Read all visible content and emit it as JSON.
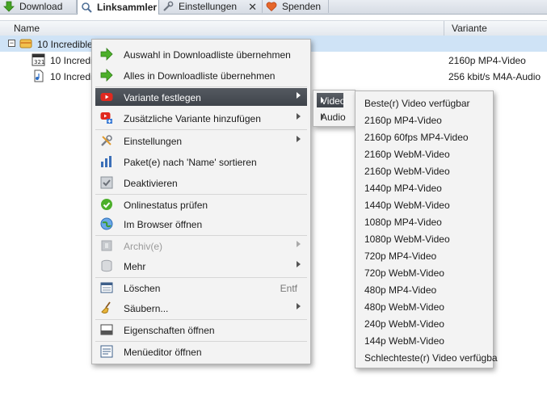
{
  "tabs": [
    {
      "label": "Download",
      "icon": "download-arrow-icon"
    },
    {
      "label": "Linksammler",
      "icon": "linkgrabber-icon"
    },
    {
      "label": "Einstellungen",
      "icon": "settings-wrench-icon",
      "close": "✕"
    },
    {
      "label": "Spenden",
      "icon": "heart-icon"
    }
  ],
  "table": {
    "columns": [
      "Name",
      "Variante"
    ],
    "rows": [
      {
        "expander": "[-]",
        "name": "10 Incredible",
        "variant": ""
      },
      {
        "name": "10 Incredi",
        "variant": "2160p MP4-Video"
      },
      {
        "name": "10 Incredi",
        "variant": "256 kbit/s M4A-Audio"
      }
    ]
  },
  "context_menu": {
    "items": [
      {
        "label": "Auswahl in Downloadliste übernehmen",
        "icon": "green-arrow-icon"
      },
      {
        "label": "Alles in Downloadliste übernehmen",
        "icon": "green-arrow-icon"
      },
      {
        "label": "Variante festlegen",
        "icon": "youtube-icon",
        "submenu": true,
        "highlighted": true
      },
      {
        "label": "Zusätzliche Variante hinzufügen",
        "icon": "youtube-add-icon",
        "submenu": true
      },
      {
        "label": "Einstellungen",
        "icon": "tools-icon",
        "submenu": true
      },
      {
        "label": "Paket(e) nach 'Name' sortieren",
        "icon": "sort-icon"
      },
      {
        "label": "Deaktivieren",
        "icon": "checkbox-icon"
      },
      {
        "label": "Onlinestatus prüfen",
        "icon": "green-check-icon"
      },
      {
        "label": "Im Browser öffnen",
        "icon": "globe-icon"
      },
      {
        "label": "Archiv(e)",
        "icon": "archive-icon",
        "submenu": true,
        "disabled": true
      },
      {
        "label": "Mehr",
        "icon": "database-icon",
        "submenu": true
      },
      {
        "label": "Löschen",
        "icon": "delete-list-icon",
        "shortcut": "Entf"
      },
      {
        "label": "Säubern...",
        "icon": "broom-icon",
        "submenu": true
      },
      {
        "label": "Eigenschaften öffnen",
        "icon": "properties-icon"
      },
      {
        "label": "Menüeditor öffnen",
        "icon": "menu-editor-icon"
      }
    ]
  },
  "submenu_type": {
    "items": [
      {
        "label": "Video",
        "highlighted": true
      },
      {
        "label": "Audio"
      }
    ]
  },
  "submenu_variants": {
    "items": [
      "Beste(r) Video verfügbar",
      "2160p MP4-Video",
      "2160p 60fps MP4-Video",
      "2160p WebM-Video",
      "2160p WebM-Video",
      "1440p MP4-Video",
      "1440p WebM-Video",
      "1080p MP4-Video",
      "1080p WebM-Video",
      "720p MP4-Video",
      "720p WebM-Video",
      "480p MP4-Video",
      "480p WebM-Video",
      "240p WebM-Video",
      "144p WebM-Video",
      "Schlechteste(r) Video verfügba"
    ]
  },
  "colors": {
    "selection": "#cfe3f6",
    "menu_highlight": "#474c53",
    "menu_bg": "#f3f3f3"
  }
}
